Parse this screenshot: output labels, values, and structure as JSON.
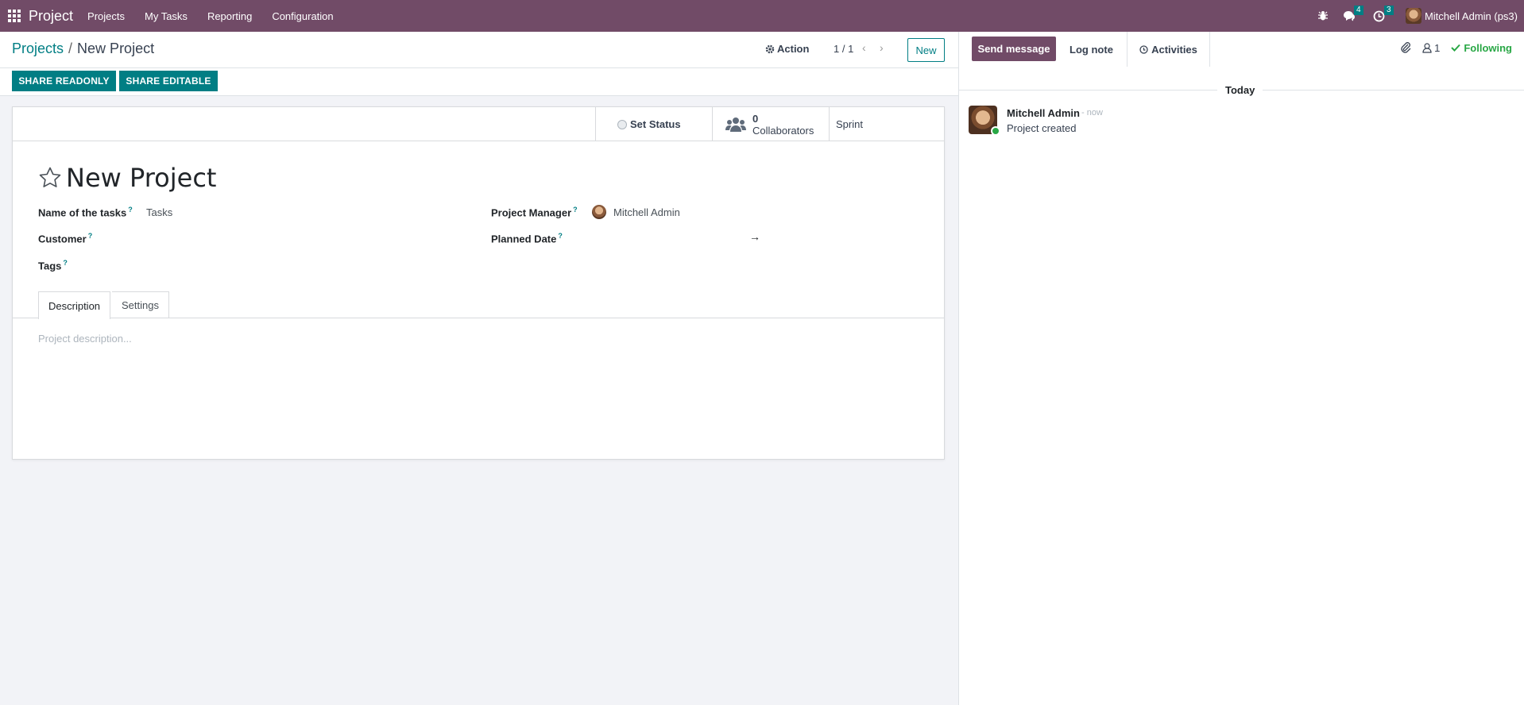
{
  "navbar": {
    "app_name": "Project",
    "menu": [
      "Projects",
      "My Tasks",
      "Reporting",
      "Configuration"
    ],
    "messages_count": "4",
    "activities_count": "3",
    "user": "Mitchell Admin (ps3)"
  },
  "control": {
    "breadcrumb_parent": "Projects",
    "breadcrumb_separator": "/",
    "breadcrumb_current": "New Project",
    "action_label": "Action",
    "pager": "1 / 1",
    "new_label": "New"
  },
  "share": {
    "readonly_label": "SHARE READONLY",
    "editable_label": "SHARE EDITABLE"
  },
  "statusbar": {
    "set_status": "Set Status",
    "collaborators_count": "0",
    "collaborators_label": "Collaborators",
    "sprint": "Sprint"
  },
  "form": {
    "title": "New Project",
    "tasks_label": "Name of the tasks",
    "tasks_value": "Tasks",
    "customer_label": "Customer",
    "tags_label": "Tags",
    "pm_label": "Project Manager",
    "pm_value": "Mitchell Admin",
    "planned_label": "Planned Date",
    "help_mark": "?",
    "arrow": "→"
  },
  "tabs": [
    "Description",
    "Settings"
  ],
  "description_placeholder": "Project description...",
  "chatter": {
    "send_message": "Send message",
    "log_note": "Log note",
    "activities": "Activities",
    "followers_count": "1",
    "following": "Following",
    "today": "Today",
    "message": {
      "author": "Mitchell Admin",
      "time": "- now",
      "body": "Project created"
    }
  },
  "colors": {
    "brand": "#714b67",
    "accent": "#017e84",
    "following": "#28a745"
  }
}
